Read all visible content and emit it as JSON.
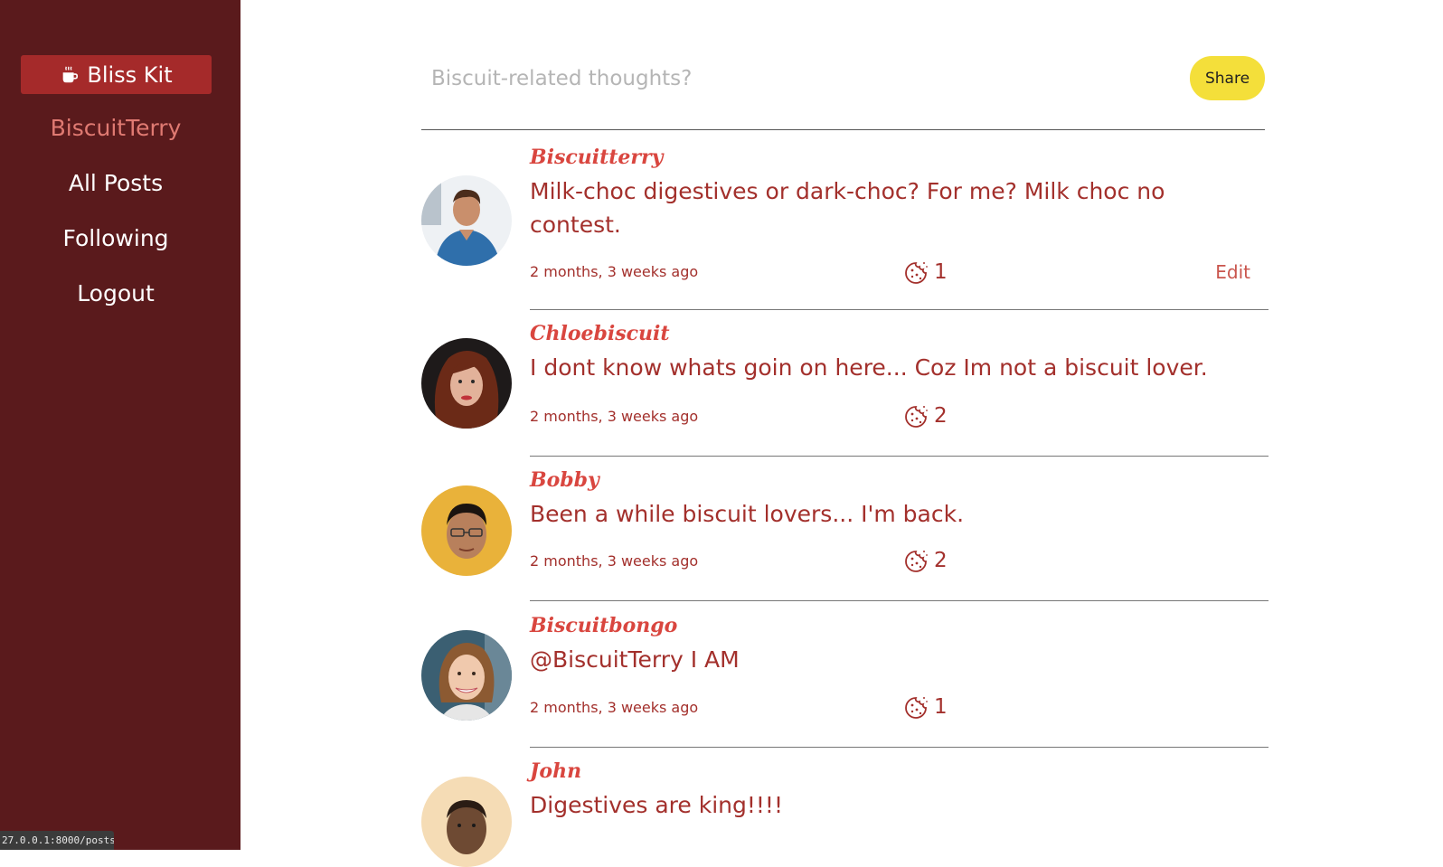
{
  "brand": {
    "label": "Bliss Kit",
    "icon": "coffee-cup-icon"
  },
  "nav": {
    "username": "BiscuitTerry",
    "all_posts": "All Posts",
    "following": "Following",
    "logout": "Logout"
  },
  "composer": {
    "placeholder": "Biscuit-related thoughts?",
    "share_label": "Share"
  },
  "posts": [
    {
      "author": "Biscuitterry",
      "body": "Milk-choc digestives or dark-choc? For me? Milk choc no contest.",
      "time": "2 months, 3 weeks ago",
      "likes": "1",
      "edit_label": "Edit"
    },
    {
      "author": "Chloebiscuit",
      "body": "I dont know whats goin on here... Coz Im not a biscuit lover.",
      "time": "2 months, 3 weeks ago",
      "likes": "2"
    },
    {
      "author": "Bobby",
      "body": "Been a while biscuit lovers... I'm back.",
      "time": "2 months, 3 weeks ago",
      "likes": "2"
    },
    {
      "author": "Biscuitbongo",
      "body": "@BiscuitTerry I AM",
      "time": "2 months, 3 weeks ago",
      "likes": "1"
    },
    {
      "author": "John",
      "body": "Digestives are king!!!!"
    }
  ],
  "status_url": "27.0.0.1:8000/posts/",
  "colors": {
    "sidebar": "#5a1a1c",
    "brand_bg": "#a52a2a",
    "accent_text": "#a3302c",
    "author": "#d9463f",
    "share_button": "#f4df3a"
  }
}
